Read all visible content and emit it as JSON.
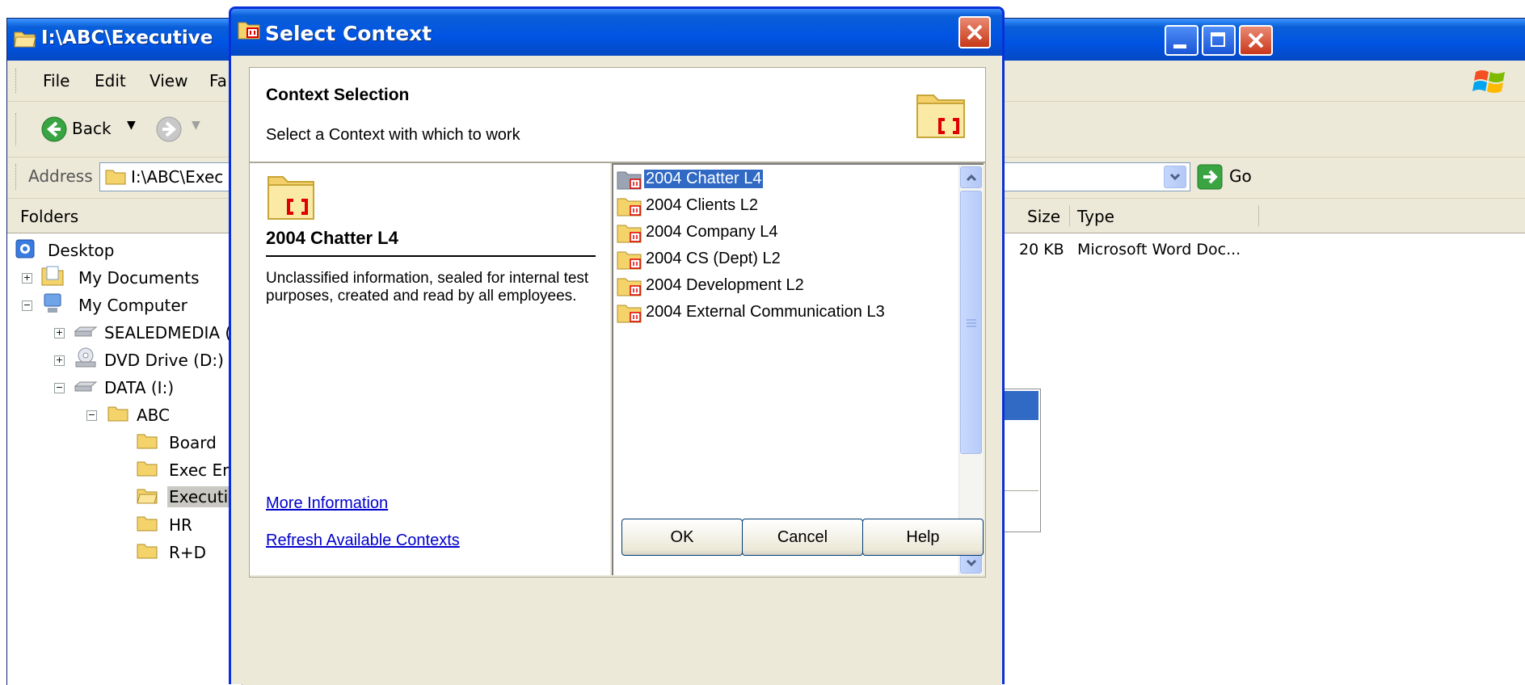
{
  "explorer": {
    "title": "I:\\ABC\\Executive",
    "menu": [
      "File",
      "Edit",
      "View",
      "Fa"
    ],
    "toolbar": {
      "back_label": "Back"
    },
    "address": {
      "label": "Address",
      "value": "I:\\ABC\\Exec",
      "go_label": "Go"
    },
    "folders_header": "Folders",
    "tree": [
      {
        "label": "Desktop"
      },
      {
        "label": "My Documents"
      },
      {
        "label": "My Computer"
      },
      {
        "label": "SEALEDMEDIA ("
      },
      {
        "label": "DVD Drive (D:)"
      },
      {
        "label": "DATA (I:)"
      },
      {
        "label": "ABC"
      },
      {
        "label": "Board"
      },
      {
        "label": "Exec Em"
      },
      {
        "label": "Executiv"
      },
      {
        "label": "HR"
      },
      {
        "label": "R+D"
      }
    ],
    "columns": {
      "size": "Size",
      "type": "Type"
    },
    "files": [
      {
        "size": "20 KB",
        "type": "Microsoft Word Doc..."
      }
    ]
  },
  "dialog": {
    "title": "Select Context",
    "header_title": "Context Selection",
    "header_subtitle": "Select a Context with which to work",
    "selected_title": "2004 Chatter L4",
    "selected_description": "Unclassified information, sealed for internal test purposes, created and read by all employees.",
    "more_info_link": "More Information",
    "refresh_link": "Refresh Available Contexts",
    "contexts": [
      {
        "label": "2004 Chatter L4",
        "selected": true
      },
      {
        "label": "2004 Clients L2"
      },
      {
        "label": "2004 Company L4"
      },
      {
        "label": "2004 CS (Dept) L2"
      },
      {
        "label": "2004 Development L2"
      },
      {
        "label": "2004 External Communication L3"
      }
    ],
    "buttons": {
      "ok": "OK",
      "cancel": "Cancel",
      "help": "Help"
    }
  },
  "colors": {
    "title_bar": "#0054e3",
    "selection": "#316ac5",
    "context_mark": "#e00000"
  }
}
